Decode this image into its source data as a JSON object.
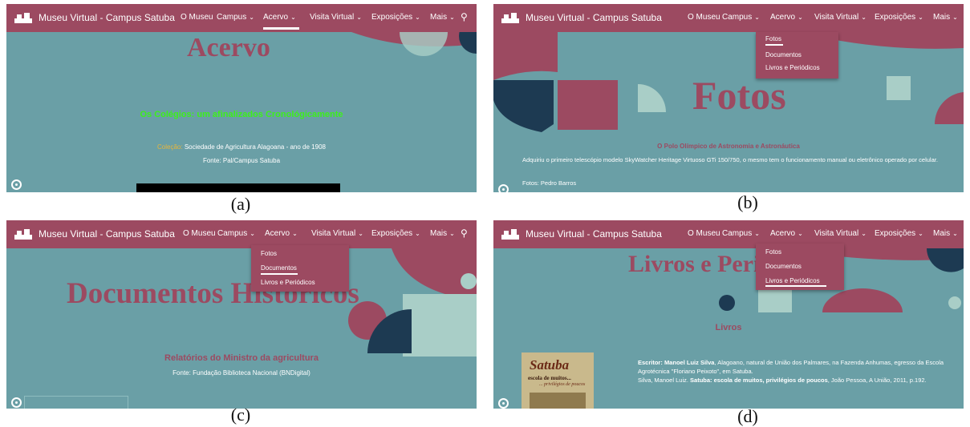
{
  "nav": {
    "brand": "Museu Virtual - Campus Satuba",
    "items": [
      "O Museu",
      "Campus",
      "Acervo",
      "Visita Virtual",
      "Exposições",
      "Mais"
    ]
  },
  "dropdown": {
    "items": [
      "Fotos",
      "Documentos",
      "Livros e Periódicos"
    ]
  },
  "panel_a": {
    "title": "Acervo",
    "headline": "Os Colégios: um afinalizados Cronológicamente",
    "colecao_label": "Coleção:",
    "colecao_value": "Sociedade de Agricultura Alagoana - ano de 1908",
    "fonte": "Fonte: Pal/Campus Satuba",
    "caption": "(a)"
  },
  "panel_b": {
    "title": "Fotos",
    "heading": "O Polo Olímpico de Astronomia e Astronáutica",
    "body": "Adquiriu o primeiro telescópio modelo SkyWatcher Heritage Virtuoso GTi 150/750, o mesmo tem o funcionamento manual ou eletrônico operado por celular.",
    "credit": "Fotos: Pedro Barros",
    "caption": "(b)"
  },
  "panel_c": {
    "title": "Documentos Históricos",
    "heading": "Relatórios do Ministro da agricultura",
    "fonte": "Fonte: Fundação Biblioteca Nacional (BNDigital)",
    "caption": "(c)"
  },
  "panel_d": {
    "title": "Livros e Periódicos",
    "section": "Livros",
    "book_cover_title": "Satuba",
    "book_cover_sub1": "escola de muitos...",
    "book_cover_sub2": "... privilégios de poucos",
    "escritor_label": "Escritor:",
    "escritor_name": "Manoel Luiz Silva",
    "escritor_text": ", Alagoano, natural de União dos Palmares, na Fazenda Anhumas, egresso da Escola Agrotécnica \"Floriano Peixoto\", em Satuba.",
    "ref_prefix": "Silva, Manoel Luiz.",
    "ref_title": "Satuba: escola de muitos, privilégios de poucos",
    "ref_suffix": ", João Pessoa, A União, 2011, p.192.",
    "caption": "(d)"
  },
  "colors": {
    "nav": "#9c4a61",
    "teal": "#6a9fa6",
    "navy": "#1d3a52",
    "mint": "#a9cec7",
    "accent_green": "#3df01a",
    "title": "#9c4a61"
  }
}
